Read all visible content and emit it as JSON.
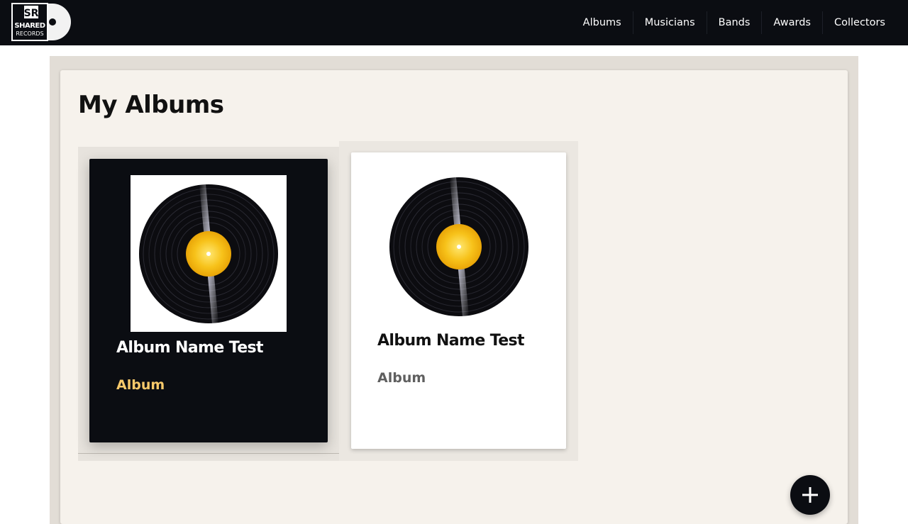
{
  "header": {
    "logo": {
      "name": "shared-records-logo",
      "line1": "SR",
      "line2": "SHARED",
      "line3": "RECORDS"
    },
    "nav": [
      {
        "label": "Albums"
      },
      {
        "label": "Musicians"
      },
      {
        "label": "Bands"
      },
      {
        "label": "Awards"
      },
      {
        "label": "Collectors"
      }
    ]
  },
  "page": {
    "title": "My Albums"
  },
  "albums": [
    {
      "name": "Album Name Test",
      "type": "Album",
      "cover_icon": "vinyl-record-icon",
      "state": "hovered"
    },
    {
      "name": "Album Name Test",
      "type": "Album",
      "cover_icon": "vinyl-record-icon",
      "state": "normal"
    }
  ],
  "fab": {
    "icon": "plus-icon",
    "action": "add-album"
  },
  "colors": {
    "topbar": "#0b0d12",
    "panel": "#f6f2ec",
    "outer": "#e2ddd6",
    "accent_gold": "#f7c96a",
    "label_gold": "#f5c518",
    "card_dark": "#0b0d12",
    "card_light": "#ffffff"
  }
}
